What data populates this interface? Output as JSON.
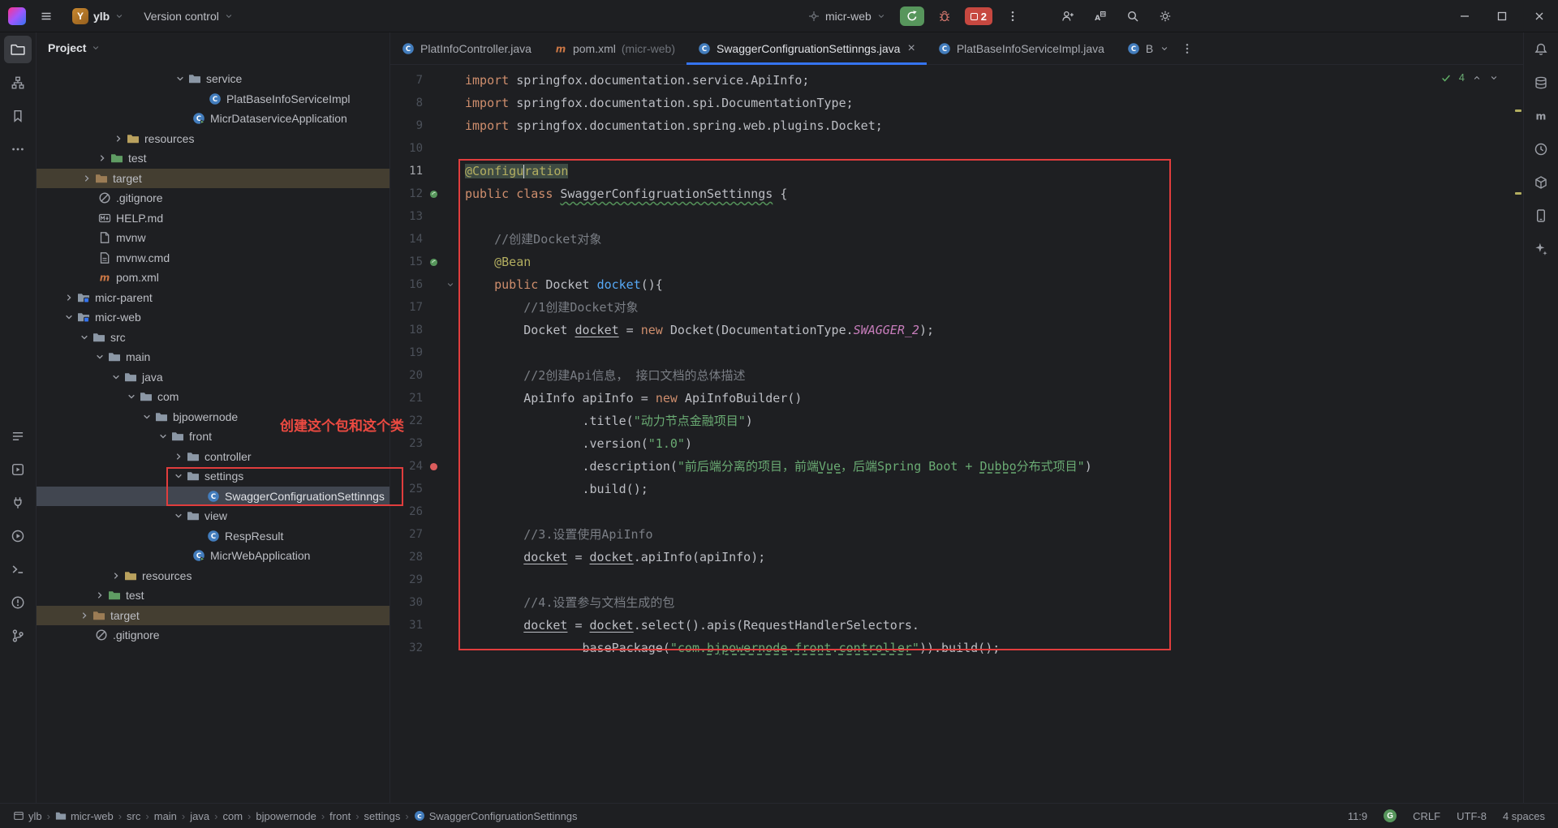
{
  "title_bar": {
    "project_avatar": "Y",
    "project_name": "ylb",
    "version_control": "Version control",
    "run_config": "micr-web",
    "process_badge": "2"
  },
  "left_toolbar": {
    "top": [
      {
        "name": "project-tool-button",
        "glyph": "folder",
        "active": true
      },
      {
        "name": "structure-tool-button",
        "glyph": "structure"
      },
      {
        "name": "bookmarks-tool-button",
        "glyph": "bookmark"
      },
      {
        "name": "more-tool-windows-button",
        "glyph": "more"
      }
    ],
    "bottom": [
      {
        "name": "todo-tool-button",
        "glyph": "todo"
      },
      {
        "name": "services-tool-button",
        "glyph": "services"
      },
      {
        "name": "build-tool-button",
        "glyph": "plug"
      },
      {
        "name": "run-tool-button",
        "glyph": "run"
      },
      {
        "name": "terminal-tool-button",
        "glyph": "terminal"
      },
      {
        "name": "problems-tool-button",
        "glyph": "problems"
      },
      {
        "name": "version-control-tool-button",
        "glyph": "branch"
      }
    ]
  },
  "right_toolbar": [
    {
      "name": "notifications-button",
      "glyph": "bell"
    },
    {
      "name": "database-tool-button",
      "glyph": "db"
    },
    {
      "name": "maven-tool-button",
      "glyph": "mletter"
    },
    {
      "name": "profiler-tool-button",
      "glyph": "clock"
    },
    {
      "name": "dependencies-tool-button",
      "glyph": "cube"
    },
    {
      "name": "device-manager-button",
      "glyph": "device"
    },
    {
      "name": "ai-assistant-button",
      "glyph": "sparkle"
    }
  ],
  "project_panel": {
    "title": "Project",
    "tree": [
      {
        "label": "service",
        "indent": 170,
        "icon": "pkg",
        "chevron": "open"
      },
      {
        "label": "PlatBaseInfoServiceImpl",
        "indent": 212,
        "icon": "class"
      },
      {
        "label": "MicrDataserviceApplication",
        "indent": 192,
        "icon": "app"
      },
      {
        "label": "resources",
        "indent": 94,
        "icon": "folder-res",
        "chevron": "closed"
      },
      {
        "label": "test",
        "indent": 74,
        "icon": "folder-test",
        "chevron": "closed"
      },
      {
        "label": "target",
        "indent": 55,
        "icon": "folder-target",
        "chevron": "closed",
        "state": "excluded"
      },
      {
        "label": ".gitignore",
        "indent": 76,
        "icon": "git"
      },
      {
        "label": "HELP.md",
        "indent": 76,
        "icon": "md"
      },
      {
        "label": "mvnw",
        "indent": 76,
        "icon": "file"
      },
      {
        "label": "mvnw.cmd",
        "indent": 76,
        "icon": "cmd"
      },
      {
        "label": "pom.xml",
        "indent": 76,
        "icon": "maven"
      },
      {
        "label": "micr-parent",
        "indent": 33,
        "icon": "module",
        "chevron": "closed"
      },
      {
        "label": "micr-web",
        "indent": 33,
        "icon": "module",
        "chevron": "open"
      },
      {
        "label": "src",
        "indent": 52,
        "icon": "folder",
        "chevron": "open"
      },
      {
        "label": "main",
        "indent": 71,
        "icon": "folder",
        "chevron": "open"
      },
      {
        "label": "java",
        "indent": 91,
        "icon": "src",
        "chevron": "open"
      },
      {
        "label": "com",
        "indent": 110,
        "icon": "pkg",
        "chevron": "open"
      },
      {
        "label": "bjpowernode",
        "indent": 129,
        "icon": "pkg",
        "chevron": "open"
      },
      {
        "label": "front",
        "indent": 149,
        "icon": "pkg",
        "chevron": "open"
      },
      {
        "label": "controller",
        "indent": 168,
        "icon": "pkg",
        "chevron": "closed"
      },
      {
        "label": "settings",
        "indent": 168,
        "icon": "pkg",
        "chevron": "open"
      },
      {
        "label": "SwaggerConfigruationSettinngs",
        "indent": 210,
        "icon": "class",
        "state": "selected"
      },
      {
        "label": "view",
        "indent": 168,
        "icon": "pkg",
        "chevron": "open"
      },
      {
        "label": "RespResult",
        "indent": 210,
        "icon": "class"
      },
      {
        "label": "MicrWebApplication",
        "indent": 192,
        "icon": "app"
      },
      {
        "label": "resources",
        "indent": 91,
        "icon": "folder-res",
        "chevron": "closed"
      },
      {
        "label": "test",
        "indent": 71,
        "icon": "folder-test",
        "chevron": "closed"
      },
      {
        "label": "target",
        "indent": 52,
        "icon": "folder-target",
        "chevron": "closed",
        "state": "excluded"
      },
      {
        "label": ".gitignore",
        "indent": 72,
        "icon": "git"
      }
    ]
  },
  "editor": {
    "tabs": [
      {
        "icon": "class",
        "label": "PlatInfoController.java"
      },
      {
        "icon": "maven",
        "label": "pom.xml",
        "suffix": " (micr-web)"
      },
      {
        "icon": "class",
        "label": "SwaggerConfigruationSettinngs.java",
        "active": true
      },
      {
        "icon": "class",
        "label": "PlatBaseInfoServiceImpl.java"
      },
      {
        "icon": "class",
        "label": "B",
        "clipped": true
      }
    ],
    "inspection_count": "4",
    "lines": [
      {
        "n": 7,
        "segs": [
          [
            "kw",
            "import"
          ],
          [
            "pln",
            " springfox.documentation.service.ApiInfo;"
          ]
        ]
      },
      {
        "n": 8,
        "segs": [
          [
            "kw",
            "import"
          ],
          [
            "pln",
            " springfox.documentation.spi.DocumentationType;"
          ]
        ]
      },
      {
        "n": 9,
        "segs": [
          [
            "kw",
            "import"
          ],
          [
            "pln",
            " springfox.documentation.spring.web.plugins.Docket;"
          ]
        ]
      },
      {
        "n": 10,
        "segs": []
      },
      {
        "n": 11,
        "current": true,
        "segs": [
          [
            "ann hl",
            "@Configu"
          ],
          [
            "caret",
            ""
          ],
          [
            "ann hl",
            "ration"
          ]
        ]
      },
      {
        "n": 12,
        "gutter": "bean",
        "segs": [
          [
            "kw",
            "public class "
          ],
          [
            "cls",
            "SwaggerConfigruationSettinngs"
          ],
          [
            "pln",
            " {"
          ]
        ]
      },
      {
        "n": 13,
        "segs": []
      },
      {
        "n": 14,
        "segs": [
          [
            "com",
            "    //创建Docket对象"
          ]
        ]
      },
      {
        "n": 15,
        "gutter": "bean",
        "segs": [
          [
            "ann",
            "    @Bean"
          ]
        ]
      },
      {
        "n": 16,
        "fold": true,
        "segs": [
          [
            "kw",
            "    public "
          ],
          [
            "pln",
            "Docket "
          ],
          [
            "mth",
            "docket"
          ],
          [
            "pln",
            "(){"
          ]
        ]
      },
      {
        "n": 17,
        "segs": [
          [
            "com",
            "        //1创建Docket对象"
          ]
        ]
      },
      {
        "n": 18,
        "segs": [
          [
            "pln",
            "        Docket "
          ],
          [
            "u",
            "docket"
          ],
          [
            "pln",
            " = "
          ],
          [
            "kw",
            "new"
          ],
          [
            "pln",
            " Docket(DocumentationType."
          ],
          [
            "sfld",
            "SWAGGER_2"
          ],
          [
            "pln",
            ");"
          ]
        ]
      },
      {
        "n": 19,
        "segs": []
      },
      {
        "n": 20,
        "segs": [
          [
            "com",
            "        //2创建Api信息， 接口文档的总体描述"
          ]
        ]
      },
      {
        "n": 21,
        "segs": [
          [
            "pln",
            "        ApiInfo apiInfo = "
          ],
          [
            "kw",
            "new"
          ],
          [
            "pln",
            " ApiInfoBuilder()"
          ]
        ]
      },
      {
        "n": 22,
        "segs": [
          [
            "pln",
            "                .title("
          ],
          [
            "str",
            "\"动力节点金融项目\""
          ],
          [
            "pln",
            ")"
          ]
        ]
      },
      {
        "n": 23,
        "segs": [
          [
            "pln",
            "                .version("
          ],
          [
            "str",
            "\"1.0\""
          ],
          [
            "pln",
            ")"
          ]
        ]
      },
      {
        "n": 24,
        "gutter": "breakpoint",
        "segs": [
          [
            "pln",
            "                .description("
          ],
          [
            "str",
            "\"前后端分离的项目，前端"
          ],
          [
            "str u",
            "Vue"
          ],
          [
            "str",
            "，后端Spring Boot + "
          ],
          [
            "str u",
            "Dubbo"
          ],
          [
            "str",
            "分布式项目\""
          ],
          [
            "pln",
            ")"
          ]
        ]
      },
      {
        "n": 25,
        "segs": [
          [
            "pln",
            "                .build();"
          ]
        ]
      },
      {
        "n": 26,
        "segs": []
      },
      {
        "n": 27,
        "segs": [
          [
            "com",
            "        //3.设置使用ApiInfo"
          ]
        ]
      },
      {
        "n": 28,
        "segs": [
          [
            "pln",
            "        "
          ],
          [
            "u",
            "docket"
          ],
          [
            "pln",
            " = "
          ],
          [
            "u",
            "docket"
          ],
          [
            "pln",
            ".apiInfo(apiInfo);"
          ]
        ]
      },
      {
        "n": 29,
        "segs": []
      },
      {
        "n": 30,
        "segs": [
          [
            "com",
            "        //4.设置参与文档生成的包"
          ]
        ]
      },
      {
        "n": 31,
        "segs": [
          [
            "pln",
            "        "
          ],
          [
            "u",
            "docket"
          ],
          [
            "pln",
            " = "
          ],
          [
            "u",
            "docket"
          ],
          [
            "pln",
            ".select().apis(RequestHandlerSelectors."
          ]
        ]
      },
      {
        "n": 32,
        "segs": [
          [
            "pln",
            "                basePackage("
          ],
          [
            "str",
            "\"com."
          ],
          [
            "str u",
            "bjpowernode"
          ],
          [
            "str",
            "."
          ],
          [
            "str u",
            "front"
          ],
          [
            "str",
            "."
          ],
          [
            "str u",
            "controller"
          ],
          [
            "str",
            "\""
          ],
          [
            "pln",
            ")).build();"
          ]
        ]
      }
    ]
  },
  "status_bar": {
    "breadcrumbs": [
      {
        "icon": "app",
        "label": "ylb"
      },
      {
        "icon": "module",
        "label": "micr-web"
      },
      {
        "label": "src"
      },
      {
        "label": "main"
      },
      {
        "label": "java"
      },
      {
        "label": "com"
      },
      {
        "label": "bjpowernode"
      },
      {
        "label": "front"
      },
      {
        "label": "settings"
      },
      {
        "icon": "class",
        "label": "SwaggerConfigruationSettinngs"
      }
    ],
    "caret": "11:9",
    "grammar": "G",
    "line_ending": "CRLF",
    "encoding": "UTF-8",
    "indent": "4 spaces"
  },
  "annotations": {
    "note": "创建这个包和这个类"
  }
}
